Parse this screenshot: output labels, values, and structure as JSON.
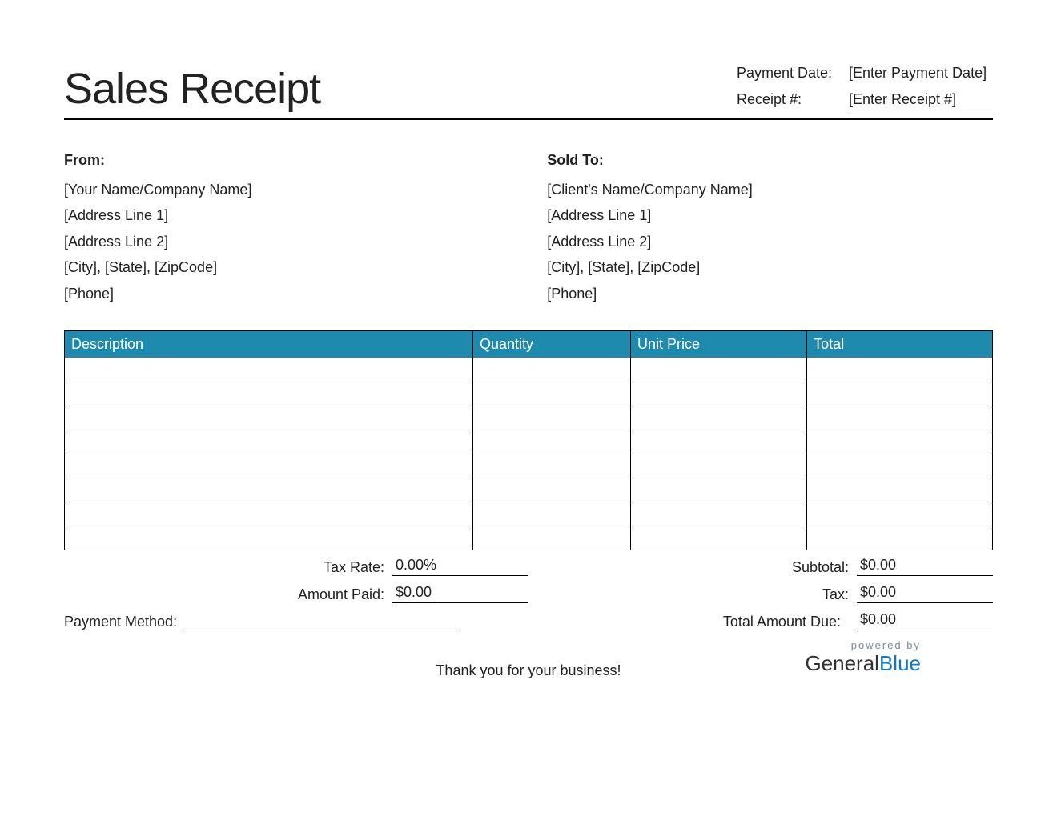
{
  "title": "Sales Receipt",
  "meta": {
    "payment_date_label": "Payment Date:",
    "payment_date_value": "[Enter Payment Date]",
    "receipt_num_label": "Receipt #:",
    "receipt_num_value": "[Enter Receipt #]"
  },
  "from": {
    "heading": "From:",
    "line1": "[Your Name/Company Name]",
    "line2": "[Address Line 1]",
    "line3": "[Address Line 2]",
    "line4": "[City], [State], [ZipCode]",
    "line5": "[Phone]"
  },
  "sold_to": {
    "heading": "Sold To:",
    "line1": "[Client's Name/Company Name]",
    "line2": "[Address Line 1]",
    "line3": "[Address Line 2]",
    "line4": "[City], [State], [ZipCode]",
    "line5": "[Phone]"
  },
  "table": {
    "headers": {
      "description": "Description",
      "quantity": "Quantity",
      "unit_price": "Unit Price",
      "total": "Total"
    },
    "rows": [
      {
        "description": "",
        "quantity": "",
        "unit_price": "",
        "total": ""
      },
      {
        "description": "",
        "quantity": "",
        "unit_price": "",
        "total": ""
      },
      {
        "description": "",
        "quantity": "",
        "unit_price": "",
        "total": ""
      },
      {
        "description": "",
        "quantity": "",
        "unit_price": "",
        "total": ""
      },
      {
        "description": "",
        "quantity": "",
        "unit_price": "",
        "total": ""
      },
      {
        "description": "",
        "quantity": "",
        "unit_price": "",
        "total": ""
      },
      {
        "description": "",
        "quantity": "",
        "unit_price": "",
        "total": ""
      },
      {
        "description": "",
        "quantity": "",
        "unit_price": "",
        "total": ""
      }
    ]
  },
  "totals": {
    "tax_rate_label": "Tax Rate:",
    "tax_rate_value": "0.00%",
    "subtotal_label": "Subtotal:",
    "subtotal_value": "$0.00",
    "amount_paid_label": "Amount Paid:",
    "amount_paid_value": "$0.00",
    "tax_label": "Tax:",
    "tax_value": "$0.00",
    "payment_method_label": "Payment Method:",
    "payment_method_value": "",
    "total_due_label": "Total Amount Due:",
    "total_due_value": "$0.00"
  },
  "footer": {
    "thanks": "Thank you for your business!",
    "powered_by": "powered by",
    "brand_general": "General",
    "brand_blue": "Blue"
  }
}
